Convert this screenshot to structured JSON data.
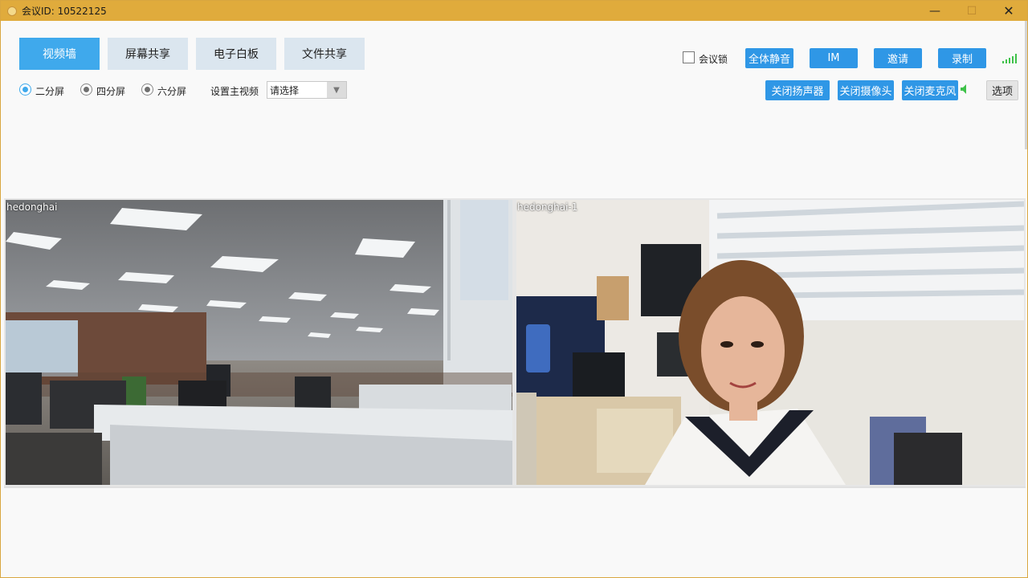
{
  "window": {
    "title": "会议ID: 10522125"
  },
  "window_controls": {
    "minimize": "—",
    "maximize": "☐",
    "close": "✕"
  },
  "tabs": [
    {
      "label": "视频墙",
      "active": true
    },
    {
      "label": "屏幕共享",
      "active": false
    },
    {
      "label": "电子白板",
      "active": false
    },
    {
      "label": "文件共享",
      "active": false
    }
  ],
  "top_controls": {
    "meeting_lock_label": "会议锁",
    "mute_all": "全体静音",
    "im": "IM",
    "invite": "邀请",
    "record": "录制"
  },
  "layout_options": [
    {
      "label": "二分屏",
      "selected": true
    },
    {
      "label": "四分屏",
      "selected": false
    },
    {
      "label": "六分屏",
      "selected": false
    }
  ],
  "main_video": {
    "label": "设置主视频",
    "selected_value": "请选择"
  },
  "media_controls": {
    "close_speaker": "关闭扬声器",
    "close_camera": "关闭摄像头",
    "close_mic": "关闭麦克风",
    "options": "选项"
  },
  "videos": [
    {
      "name": "hedonghai",
      "scene": "office"
    },
    {
      "name": "hedonghai-1",
      "scene": "person"
    }
  ],
  "colors": {
    "titlebar": "#e0ab3c",
    "accent": "#3fa9ec",
    "button": "#2f97e6",
    "signal": "#3fc24a"
  }
}
